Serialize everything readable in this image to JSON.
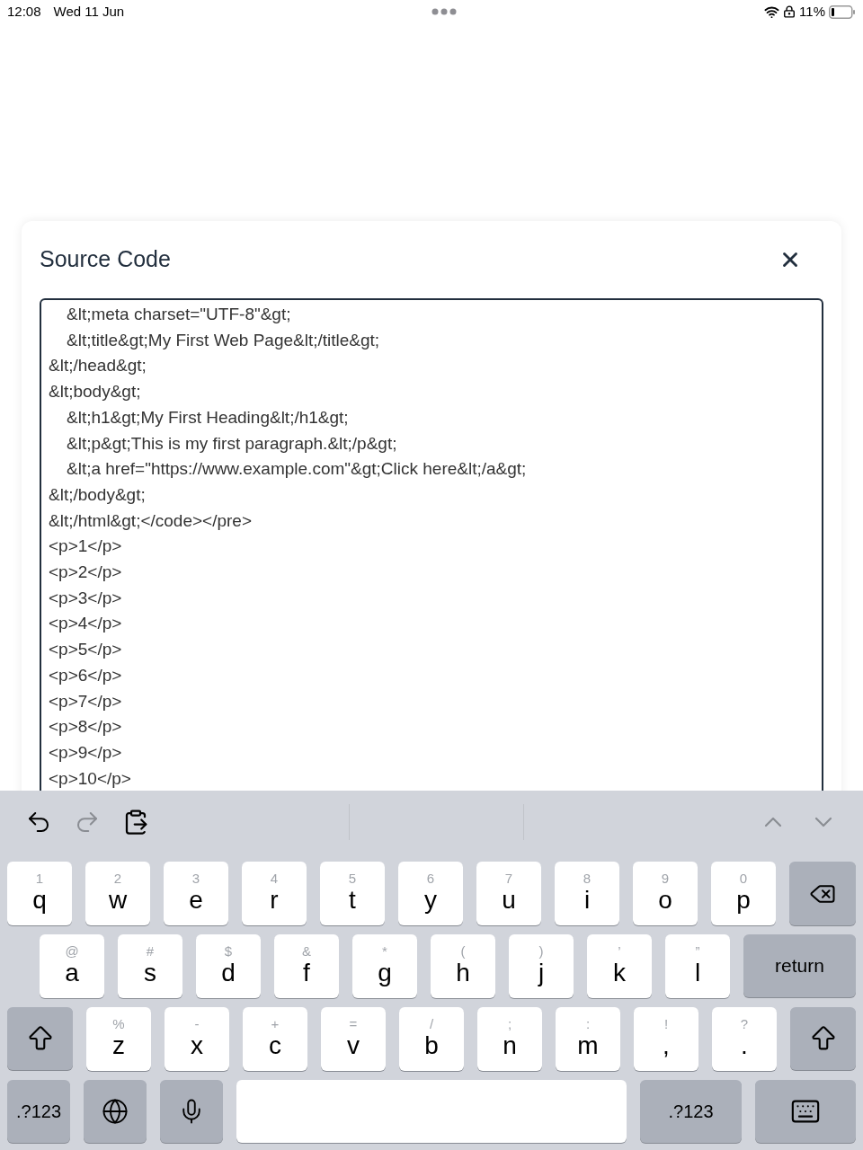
{
  "status_bar": {
    "time": "12:08",
    "date": "Wed 11 Jun",
    "battery": "11%"
  },
  "dialog": {
    "title": "Source Code",
    "code_lines": [
      {
        "text": "&lt;meta charset=\"UTF-8\"&gt;",
        "indented": true
      },
      {
        "text": "&lt;title&gt;My First Web Page&lt;/title&gt;",
        "indented": true
      },
      {
        "text": "&lt;/head&gt;",
        "indented": false
      },
      {
        "text": "&lt;body&gt;",
        "indented": false
      },
      {
        "text": "&lt;h1&gt;My First Heading&lt;/h1&gt;",
        "indented": true
      },
      {
        "text": "&lt;p&gt;This is my first paragraph.&lt;/p&gt;",
        "indented": true
      },
      {
        "text": "&lt;a href=\"https://www.example.com\"&gt;Click here&lt;/a&gt;",
        "indented": true
      },
      {
        "text": "&lt;/body&gt;",
        "indented": false
      },
      {
        "text": "&lt;/html&gt;</code></pre>",
        "indented": false
      },
      {
        "text": "<p>1</p>",
        "indented": false
      },
      {
        "text": "<p>2</p>",
        "indented": false
      },
      {
        "text": "<p>3</p>",
        "indented": false
      },
      {
        "text": "<p>4</p>",
        "indented": false
      },
      {
        "text": "<p>5</p>",
        "indented": false
      },
      {
        "text": "<p>6</p>",
        "indented": false
      },
      {
        "text": "<p>7</p>",
        "indented": false
      },
      {
        "text": "<p>8</p>",
        "indented": false
      },
      {
        "text": "<p>9</p>",
        "indented": false
      },
      {
        "text": "<p>10</p>",
        "indented": false
      }
    ]
  },
  "keyboard": {
    "rows": [
      [
        {
          "kind": "letter",
          "main": "q",
          "hint": "1"
        },
        {
          "kind": "letter",
          "main": "w",
          "hint": "2"
        },
        {
          "kind": "letter",
          "main": "e",
          "hint": "3"
        },
        {
          "kind": "letter",
          "main": "r",
          "hint": "4"
        },
        {
          "kind": "letter",
          "main": "t",
          "hint": "5"
        },
        {
          "kind": "letter",
          "main": "y",
          "hint": "6"
        },
        {
          "kind": "letter",
          "main": "u",
          "hint": "7"
        },
        {
          "kind": "letter",
          "main": "i",
          "hint": "8"
        },
        {
          "kind": "letter",
          "main": "o",
          "hint": "9"
        },
        {
          "kind": "letter",
          "main": "p",
          "hint": "0"
        },
        {
          "kind": "delete"
        }
      ],
      [
        {
          "kind": "letter",
          "main": "a",
          "hint": "@"
        },
        {
          "kind": "letter",
          "main": "s",
          "hint": "#"
        },
        {
          "kind": "letter",
          "main": "d",
          "hint": "$"
        },
        {
          "kind": "letter",
          "main": "f",
          "hint": "&"
        },
        {
          "kind": "letter",
          "main": "g",
          "hint": "*"
        },
        {
          "kind": "letter",
          "main": "h",
          "hint": "("
        },
        {
          "kind": "letter",
          "main": "j",
          "hint": ")"
        },
        {
          "kind": "letter",
          "main": "k",
          "hint": "’"
        },
        {
          "kind": "letter",
          "main": "l",
          "hint": "”"
        },
        {
          "kind": "return",
          "main": "return"
        }
      ],
      [
        {
          "kind": "shift"
        },
        {
          "kind": "letter",
          "main": "z",
          "hint": "%"
        },
        {
          "kind": "letter",
          "main": "x",
          "hint": "-"
        },
        {
          "kind": "letter",
          "main": "c",
          "hint": "+"
        },
        {
          "kind": "letter",
          "main": "v",
          "hint": "="
        },
        {
          "kind": "letter",
          "main": "b",
          "hint": "/"
        },
        {
          "kind": "letter",
          "main": "n",
          "hint": ";"
        },
        {
          "kind": "letter",
          "main": "m",
          "hint": ":"
        },
        {
          "kind": "letter",
          "main": ",",
          "hint": "!"
        },
        {
          "kind": "letter",
          "main": ".",
          "hint": "?"
        },
        {
          "kind": "shift"
        }
      ],
      [
        {
          "kind": "mode",
          "main": ".?123"
        },
        {
          "kind": "globe"
        },
        {
          "kind": "mic"
        },
        {
          "kind": "space"
        },
        {
          "kind": "mode",
          "main": ".?123",
          "wide": true
        },
        {
          "kind": "hide"
        }
      ]
    ]
  }
}
